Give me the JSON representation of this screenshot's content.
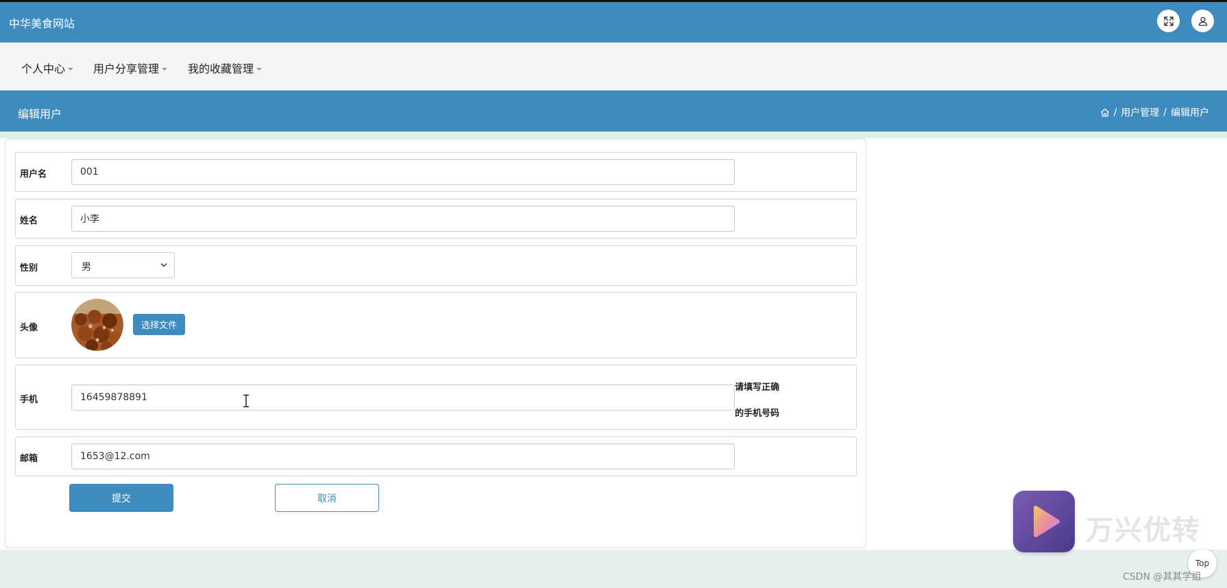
{
  "header": {
    "site_title": "中华美食网站"
  },
  "menu": {
    "items": [
      {
        "label": "个人中心"
      },
      {
        "label": "用户分享管理"
      },
      {
        "label": "我的收藏管理"
      }
    ]
  },
  "title_bar": {
    "page_title": "编辑用户",
    "breadcrumb": [
      "用户管理",
      "编辑用户"
    ],
    "separator": "/"
  },
  "form": {
    "username": {
      "label": "用户名",
      "value": "001"
    },
    "name": {
      "label": "姓名",
      "value": "小李"
    },
    "gender": {
      "label": "性别",
      "value": "男"
    },
    "avatar": {
      "label": "头像",
      "file_button": "选择文件"
    },
    "phone": {
      "label": "手机",
      "value": "16459878891",
      "hint_line1": "请填写正确",
      "hint_line2": "的手机号码"
    },
    "email": {
      "label": "邮箱",
      "value": "1653@12.com"
    },
    "submit_label": "提交",
    "cancel_label": "取消"
  },
  "watermark": {
    "text": "万兴优转"
  },
  "back_to_top": {
    "label": "Top"
  },
  "credit": {
    "text": "CSDN @其其学姐"
  },
  "colors": {
    "primary": "#3d8bbf",
    "menu_bg": "#f5f5f5",
    "page_bg": "#e8f1ee"
  },
  "icons": {
    "expand": "expand-icon",
    "user": "user-icon",
    "home": "home-icon",
    "select_chevron": "chevron-down-icon",
    "text_cursor": "text-cursor-icon"
  }
}
